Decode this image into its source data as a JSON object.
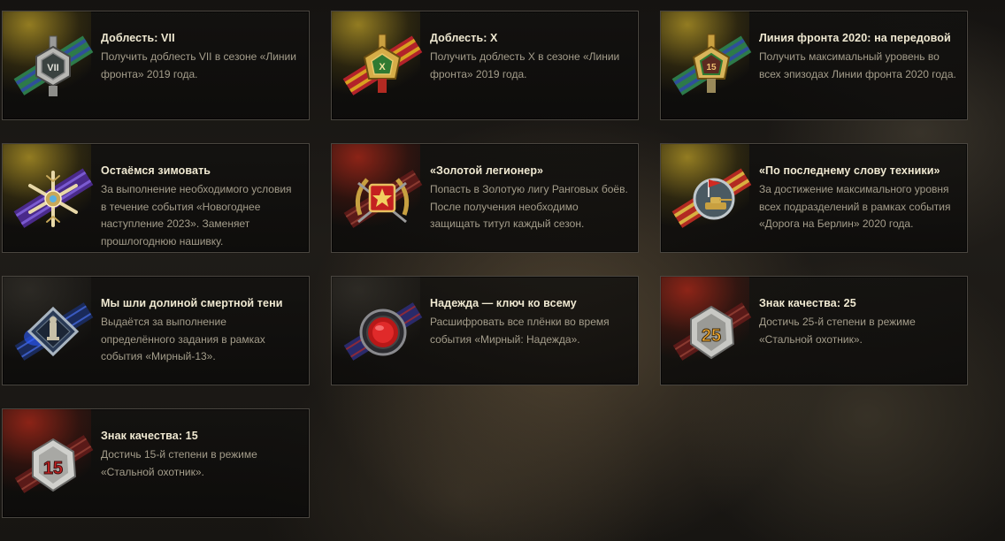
{
  "achievements": [
    {
      "title": "Доблесть: VII",
      "description": "Получить доблесть VII в сезоне «Линии фронта» 2019 года.",
      "theme": "gold",
      "icon": "valor-vii-medal-icon",
      "badge_text": "VII"
    },
    {
      "title": "Доблесть: X",
      "description": "Получить доблесть X в сезоне «Линии фронта» 2019 года.",
      "theme": "gold",
      "icon": "valor-x-medal-icon",
      "badge_text": "X"
    },
    {
      "title": "Линия фронта 2020: на передовой",
      "description": "Получить максимальный уровень во всех эпизодах Линии фронта 2020 года.",
      "theme": "gold",
      "icon": "frontline-2020-medal-icon",
      "badge_text": "15"
    },
    {
      "title": "Остаёмся зимовать",
      "description": "За выполнение необходимого условия в течение события «Новогоднее наступление 2023». Заменяет прошлогоднюю нашивку.",
      "theme": "gold",
      "icon": "snowflake-badge-icon"
    },
    {
      "title": "«Золотой легионер»",
      "description": "Попасть в Золотую лигу Ранговых боёв. После получения необходимо защищать титул каждый сезон.",
      "theme": "red",
      "icon": "golden-legionnaire-star-icon"
    },
    {
      "title": "«По последнему слову техники»",
      "description": "За достижение максимального уровня всех подразделений в рамках события «Дорога на Берлин» 2020 года.",
      "theme": "gold",
      "icon": "tank-flag-badge-icon"
    },
    {
      "title": "Мы шли долиной смертной тени",
      "description": "Выдаётся за выполнение определённого задания в рамках события «Мирный-13».",
      "theme": "plain",
      "icon": "mirny-diamond-badge-icon"
    },
    {
      "title": "Надежда — ключ ко всему",
      "description": "Расшифровать все плёнки во время события «Мирный: Надежда».",
      "theme": "plain",
      "icon": "hope-red-orb-badge-icon"
    },
    {
      "title": "Знак качества: 25",
      "description": "Достичь 25-й степени в режиме «Стальной охотник».",
      "theme": "red",
      "icon": "quality-mark-25-icon",
      "badge_text": "25"
    },
    {
      "title": "Знак качества: 15",
      "description": "Достичь 15-й степени в режиме «Стальной охотник».",
      "theme": "red",
      "icon": "quality-mark-15-icon",
      "badge_text": "15"
    }
  ]
}
